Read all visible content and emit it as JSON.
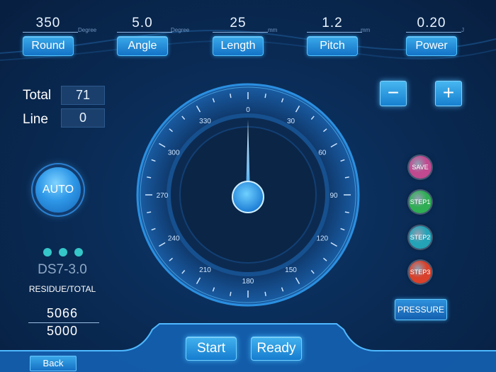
{
  "params": [
    {
      "value": "350",
      "unit": "Degree",
      "label": "Round"
    },
    {
      "value": "5.0",
      "unit": "Degree",
      "label": "Angle"
    },
    {
      "value": "25",
      "unit": "mm",
      "label": "Length"
    },
    {
      "value": "1.2",
      "unit": "mm",
      "label": "Pitch"
    },
    {
      "value": "0.20",
      "unit": "J",
      "label": "Power"
    }
  ],
  "counters": {
    "total_label": "Total",
    "total_value": "71",
    "line_label": "Line",
    "line_value": "0"
  },
  "controls": {
    "minus": "−",
    "plus": "+"
  },
  "auto_label": "AUTO",
  "device": {
    "model": "DS7-3.0",
    "residue_label": "RESIDUE/TOTAL",
    "residue": "5066",
    "total": "5000"
  },
  "gauge": {
    "ticks": [
      "0",
      "30",
      "60",
      "90",
      "120",
      "150",
      "180",
      "210",
      "240",
      "270",
      "300",
      "330"
    ],
    "needle_angle_deg": 0
  },
  "side_buttons": [
    {
      "label": "SAVE",
      "color": "#c1498f"
    },
    {
      "label": "STEP1",
      "color": "#2fae54"
    },
    {
      "label": "STEP2",
      "color": "#24a3b7"
    },
    {
      "label": "STEP3",
      "color": "#d9412a"
    }
  ],
  "pressure_label": "PRESSURE",
  "start_label": "Start",
  "ready_label": "Ready",
  "back_label": "Back"
}
